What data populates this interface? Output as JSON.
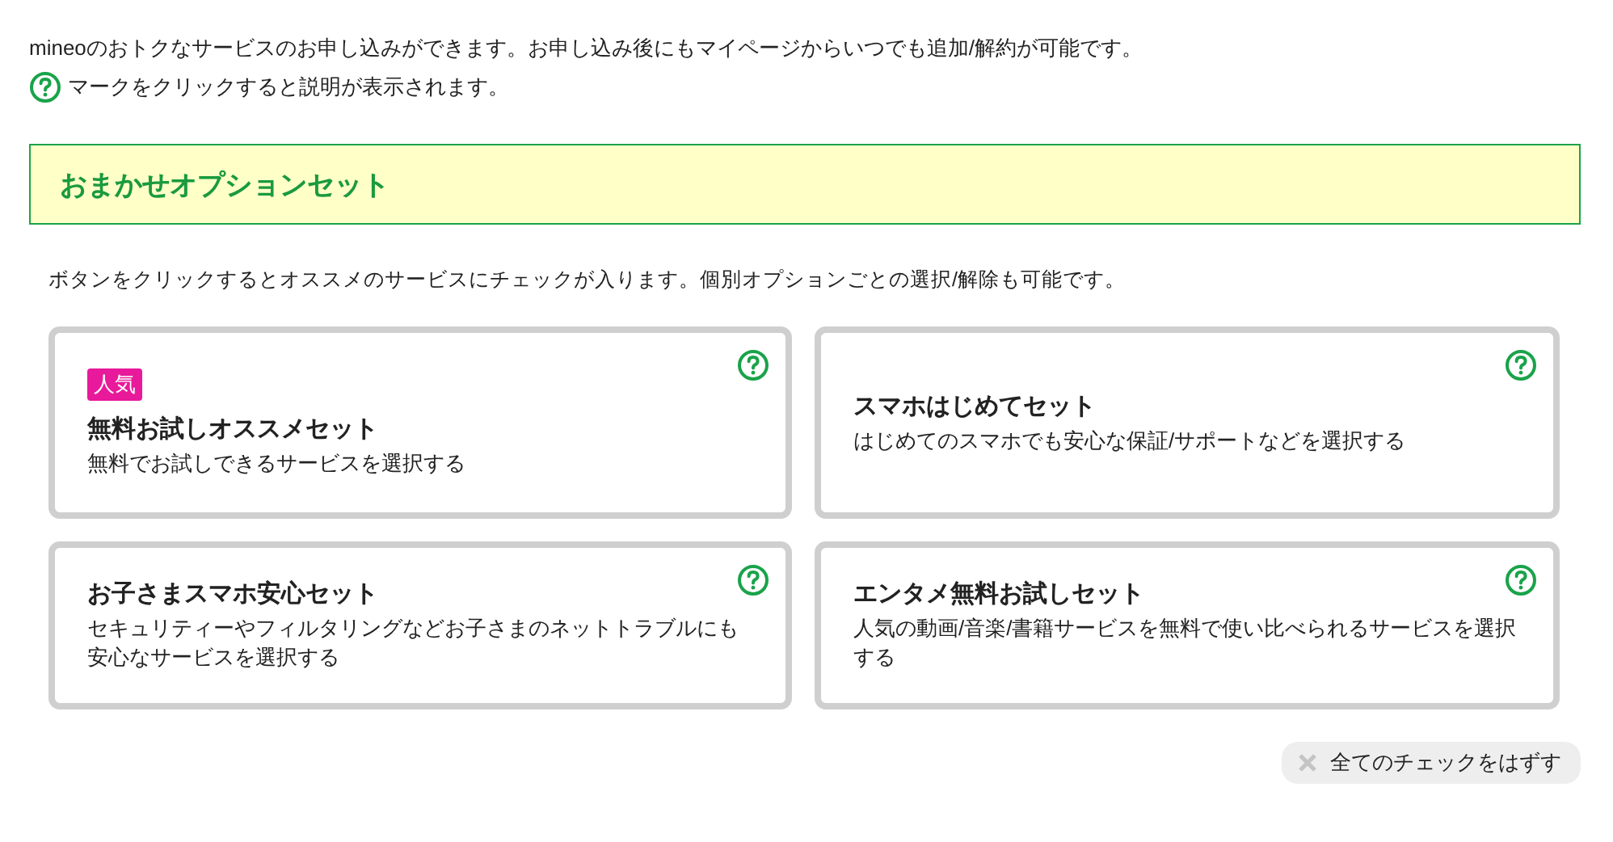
{
  "intro": {
    "line1": "mineoのおトクなサービスのお申し込みができます。お申し込み後にもマイページからいつでも追加/解約が可能です。",
    "line2": "マークをクリックすると説明が表示されます。"
  },
  "section": {
    "title": "おまかせオプションセット",
    "description": "ボタンをクリックするとオススメのサービスにチェックが入ります。個別オプションごとの選択/解除も可能です。"
  },
  "sets": [
    {
      "badge": "人気",
      "title": "無料お試しオススメセット",
      "description": "無料でお試しできるサービスを選択する"
    },
    {
      "title": "スマホはじめてセット",
      "description": "はじめてのスマホでも安心な保証/サポートなどを選択する"
    },
    {
      "title": "お子さまスマホ安心セット",
      "description": "セキュリティーやフィルタリングなどお子さまのネットトラブルにも安心なサービスを選択する"
    },
    {
      "title": "エンタメ無料お試しセット",
      "description": "人気の動画/音楽/書籍サービスを無料で使い比べられるサービスを選択する"
    }
  ],
  "clear_button": {
    "label": "全てのチェックをはずす"
  }
}
